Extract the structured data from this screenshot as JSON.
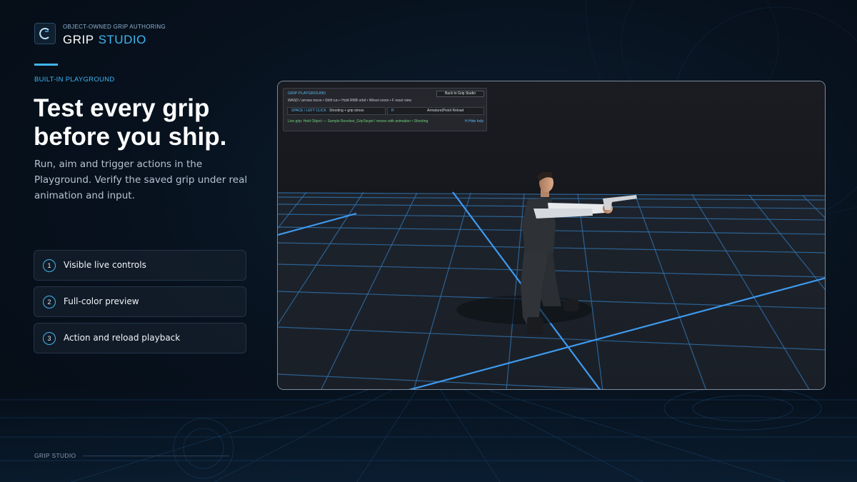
{
  "brand": {
    "tagline": "OBJECT-OWNED GRIP AUTHORING",
    "title_primary": "GRIP",
    "title_accent": "STUDIO"
  },
  "section_label": "BUILT-IN PLAYGROUND",
  "headline": {
    "line1": "Test every grip",
    "line2": "before you ship."
  },
  "description": "Run, aim and trigger actions in the Playground. Verify the saved grip under real animation and input.",
  "features": [
    {
      "number": "1",
      "label": "Visible live controls"
    },
    {
      "number": "2",
      "label": "Full-color preview"
    },
    {
      "number": "3",
      "label": "Action and reload playback"
    }
  ],
  "footer": {
    "label": "GRIP STUDIO"
  },
  "playground": {
    "title": "GRIP PLAYGROUND",
    "back_button": "Back to Grip Studio",
    "controls_hint": "WASD / arrows move  •  Shift run  •  Hold RMB orbit  •  Wheel zoom  •  F reset view",
    "bindings": [
      {
        "key": "SPACE / LEFT CLICK",
        "action": "Shooting + grip stress"
      },
      {
        "key": "R",
        "action": "Armature|Pistol Reload"
      }
    ],
    "status": "Live grip: Held Object — Sample Revolver_GripTarget  /  moves with animation  •  Shooting",
    "help_hint": "H  Hide help"
  },
  "colors": {
    "accent": "#3fb6f2",
    "background": "#07111d",
    "grid_line": "#3a8fe0",
    "status_green": "#6fd17a"
  },
  "icons": {
    "logo": "grip-studio-logo-icon"
  }
}
